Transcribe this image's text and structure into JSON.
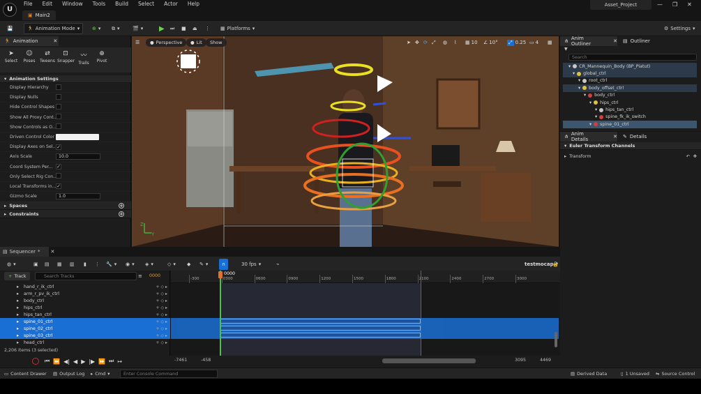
{
  "window": {
    "logo": "U",
    "menu": [
      "File",
      "Edit",
      "Window",
      "Tools",
      "Build",
      "Select",
      "Actor",
      "Help"
    ],
    "doc_tab": "Main2",
    "project": "Asset_Project",
    "controls": [
      "—",
      "❐",
      "✕"
    ]
  },
  "toolbar": {
    "mode": "Animation Mode",
    "platforms": "Platforms",
    "settings": "Settings"
  },
  "animation_panel": {
    "tab": "Animation",
    "tools": [
      {
        "label": "Select",
        "icon": "arrow-icon"
      },
      {
        "label": "Poses",
        "icon": "pose-icon"
      },
      {
        "label": "Tweens",
        "icon": "tween-icon"
      },
      {
        "label": "Snapper",
        "icon": "snapper-icon"
      },
      {
        "label": "Trails",
        "icon": "trails-icon"
      },
      {
        "label": "Pivot",
        "icon": "pivot-icon"
      }
    ],
    "section": "Animation Settings",
    "props": [
      {
        "label": "Display Hierarchy",
        "type": "check",
        "checked": false
      },
      {
        "label": "Display Nulls",
        "type": "check",
        "checked": false
      },
      {
        "label": "Hide Control Shapes",
        "type": "check",
        "checked": false
      },
      {
        "label": "Show All Proxy Cont...",
        "type": "check",
        "checked": false
      },
      {
        "label": "Show Controls as O...",
        "type": "check",
        "checked": false
      },
      {
        "label": "Driven Control Color",
        "type": "color",
        "value": "#f2f2f2"
      },
      {
        "label": "Display Axes on Sel...",
        "type": "check",
        "checked": true
      },
      {
        "label": "Axis Scale",
        "type": "field",
        "value": "10.0"
      },
      {
        "label": "Coord System Per...",
        "type": "check",
        "checked": true
      },
      {
        "label": "Only Select Rig Con...",
        "type": "check",
        "checked": false
      },
      {
        "label": "Local Transforms in...",
        "type": "check",
        "checked": true
      },
      {
        "label": "Gizmo Scale",
        "type": "field",
        "value": "1.0"
      }
    ],
    "collapsibles": [
      "Spaces",
      "Constraints"
    ]
  },
  "viewport": {
    "perspective": "Perspective",
    "lit": "Lit",
    "show": "Show",
    "snap_grid": "10",
    "snap_rot": "10°",
    "snap_scale": "0.25",
    "camera_speed": "4",
    "axis_y": "Y",
    "axis_z": "Z"
  },
  "outliner": {
    "tab_anim": "Anim Outliner",
    "tab_world": "Outliner",
    "search_placeholder": "Search",
    "rows": [
      {
        "label": "CR_Mannequin_Body  (BP_Piatut)",
        "indent": 8,
        "color": "#c8c8c8",
        "state": "sel"
      },
      {
        "label": "global_ctrl",
        "indent": 14,
        "color": "#e0c040",
        "state": "sel"
      },
      {
        "label": "root_ctrl",
        "indent": 22,
        "color": "#c8c8c8",
        "state": ""
      },
      {
        "label": "body_offset_ctrl",
        "indent": 22,
        "color": "#e0c040",
        "state": "sel"
      },
      {
        "label": "body_ctrl",
        "indent": 30,
        "color": "#d04040",
        "state": ""
      },
      {
        "label": "hips_ctrl",
        "indent": 38,
        "color": "#e0c040",
        "state": ""
      },
      {
        "label": "hips_tan_ctrl",
        "indent": 46,
        "color": "#c8c8c8",
        "state": ""
      },
      {
        "label": "spine_fk_ik_switch",
        "indent": 46,
        "color": "#d04040",
        "state": ""
      },
      {
        "label": "spine_01_ctrl",
        "indent": 38,
        "color": "#d04040",
        "state": "hl"
      }
    ]
  },
  "anim_details": {
    "tab": "Anim Details",
    "tab2": "Details",
    "section": "Euler Transform Channels",
    "transform": "Transform"
  },
  "sequencer": {
    "tab": "Sequencer",
    "fps": "30 fps",
    "sequence_name": "testmocap",
    "add_track": "Track",
    "search_placeholder": "Search Tracks",
    "current_frame": "0000",
    "playhead_label": "0000",
    "tracks": [
      {
        "label": "hand_r_ik_ctrl",
        "sel": false
      },
      {
        "label": "arm_r_pv_ik_ctrl",
        "sel": false
      },
      {
        "label": "body_ctrl",
        "sel": false
      },
      {
        "label": "hips_ctrl",
        "sel": false
      },
      {
        "label": "hips_tan_ctrl",
        "sel": false
      },
      {
        "label": "spine_01_ctrl",
        "sel": true
      },
      {
        "label": "spine_02_ctrl",
        "sel": true
      },
      {
        "label": "spine_03_ctrl",
        "sel": true
      },
      {
        "label": "head_ctrl",
        "sel": false
      }
    ],
    "item_count": "2,206 items (3 selected)",
    "ticks": [
      "-300",
      "0300",
      "0600",
      "0900",
      "1200",
      "1500",
      "1800",
      "2100",
      "2400",
      "2700",
      "3000"
    ],
    "range_start": "-7461",
    "range_in": "-458",
    "range_out": "3095",
    "range_end": "4469"
  },
  "statusbar": {
    "content_drawer": "Content Drawer",
    "output_log": "Output Log",
    "cmd": "Cmd",
    "console_placeholder": "Enter Console Command",
    "derived_data": "Derived Data",
    "unsaved": "1 Unsaved",
    "source_control": "Source Control"
  }
}
